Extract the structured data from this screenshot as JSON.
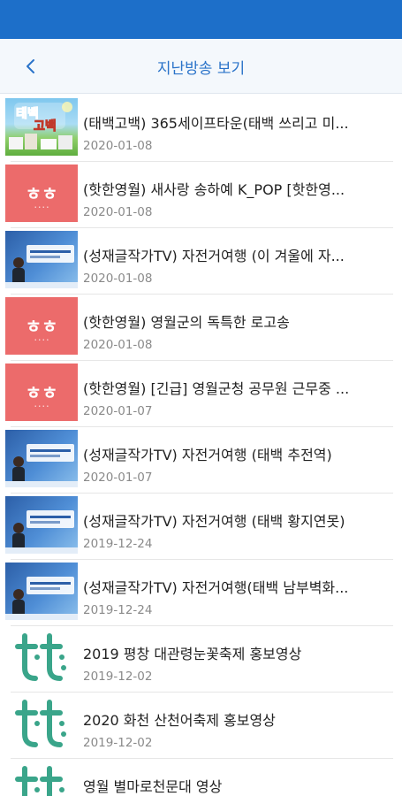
{
  "header": {
    "title": "지난방송 보기",
    "back_icon": "back-arrow-icon"
  },
  "colors": {
    "status_bar": "#1d6fc9",
    "title": "#2a73c9",
    "hh_thumb": "#ec6b6b",
    "tt_logo": "#3aa58a"
  },
  "list": {
    "items": [
      {
        "title": "(태백고백) 365세이프타운(태백 쓰리고 미...",
        "date": "2020-01-08",
        "thumb": "taebaek-gobaek"
      },
      {
        "title": "(핫한영월) 새사랑 송하예 K_POP [핫한영...",
        "date": "2020-01-08",
        "thumb": "hothan-yeongwol"
      },
      {
        "title": "(성재글작가TV) 자전거여행 (이 겨울에 자...",
        "date": "2020-01-08",
        "thumb": "seongjae-tv"
      },
      {
        "title": "(핫한영월) 영월군의 독특한 로고송",
        "date": "2020-01-08",
        "thumb": "hothan-yeongwol"
      },
      {
        "title": "(핫한영월) [긴급] 영월군청 공무원 근무중 ...",
        "date": "2020-01-07",
        "thumb": "hothan-yeongwol"
      },
      {
        "title": "(성재글작가TV) 자전거여행 (태백 추전역)",
        "date": "2020-01-07",
        "thumb": "seongjae-tv"
      },
      {
        "title": "(성재글작가TV) 자전거여행 (태백 황지연못)",
        "date": "2019-12-24",
        "thumb": "seongjae-tv"
      },
      {
        "title": "(성재글작가TV) 자전거여행(태백 남부벽화...",
        "date": "2019-12-24",
        "thumb": "seongjae-tv"
      },
      {
        "title": "2019 평창 대관령눈꽃축제 홍보영상",
        "date": "2019-12-02",
        "thumb": "tt-logo"
      },
      {
        "title": "2020 화천 산천어축제 홍보영상",
        "date": "2019-12-02",
        "thumb": "tt-logo"
      },
      {
        "title": "영월 별마로천문대 영상",
        "date": "",
        "thumb": "tt-logo"
      }
    ]
  }
}
